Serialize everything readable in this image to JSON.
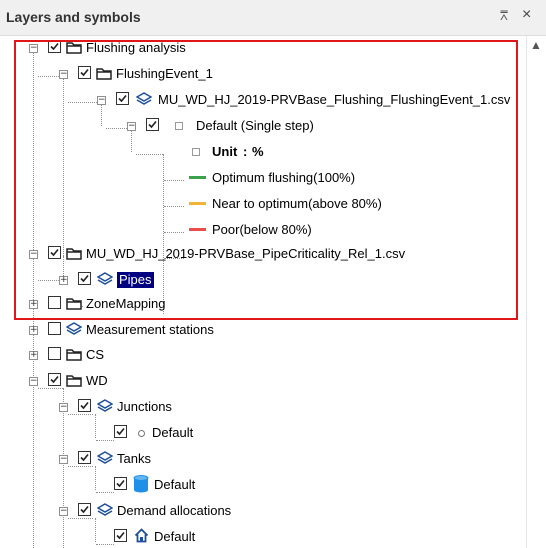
{
  "panel": {
    "title": "Layers and symbols",
    "pin_glyph": "⩞",
    "close_glyph": "×"
  },
  "tree": {
    "flushing_analysis": "Flushing analysis",
    "flushing_event": "FlushingEvent_1",
    "flushing_layer": "MU_WD_HJ_2019-PRVBase_Flushing_FlushingEvent_1.csv",
    "default_single_step": "Default (Single step)",
    "unit_label": "Unit",
    "unit_value": "%",
    "legend": [
      {
        "label": "Optimum flushing(100%)",
        "color": "#3aa24a"
      },
      {
        "label": "Near to optimum(above 80%)",
        "color": "#f5b335"
      },
      {
        "label": "Poor(below 80%)",
        "color": "#ee4b4b"
      }
    ],
    "pipe_criticality": "MU_WD_HJ_2019-PRVBase_PipeCriticality_Rel_1.csv",
    "pipes": "Pipes",
    "zone_mapping": "ZoneMapping",
    "measurement_stations": "Measurement stations",
    "cs": "CS",
    "wd": "WD",
    "junctions": "Junctions",
    "junctions_default": "Default",
    "tanks": "Tanks",
    "tanks_default": "Default",
    "demand_allocations": "Demand allocations",
    "demand_default": "Default"
  },
  "colors": {
    "highlight_border": "#e0161b",
    "selection_bg": "#000080",
    "layer_icon": "#1c4f9c",
    "tank_icon": "#1e90e8"
  },
  "icons": {
    "folder": "folder-icon",
    "layer": "layers-icon",
    "tank": "tank-icon",
    "demand": "house-icon",
    "junction": "junction-dot-icon"
  }
}
